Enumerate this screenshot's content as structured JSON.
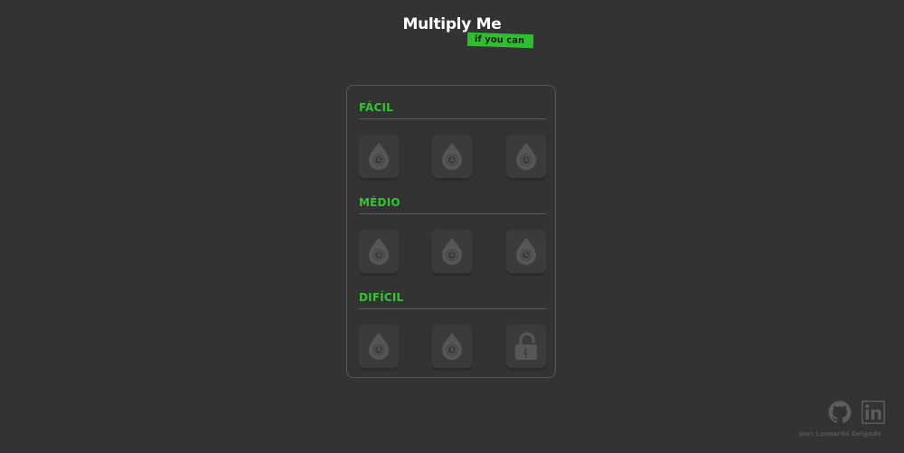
{
  "app": {
    "title": "Multiply Me",
    "subtitle": "if you can"
  },
  "sections": [
    {
      "label": "FÁCIL",
      "levels": [
        {
          "icon": "timer-drop-icon",
          "locked": false
        },
        {
          "icon": "timer-drop-icon",
          "locked": false
        },
        {
          "icon": "timer-drop-icon",
          "locked": false
        }
      ]
    },
    {
      "label": "MÉDIO",
      "levels": [
        {
          "icon": "timer-drop-icon",
          "locked": false
        },
        {
          "icon": "timer-drop-icon",
          "locked": false
        },
        {
          "icon": "timer-drop-icon",
          "locked": false
        }
      ]
    },
    {
      "label": "DIFÍCIL",
      "levels": [
        {
          "icon": "timer-drop-icon",
          "locked": false
        },
        {
          "icon": "timer-drop-icon",
          "locked": false
        },
        {
          "icon": "unlock-icon",
          "locked": false
        }
      ]
    }
  ],
  "footer": {
    "credit": "por: Leonardo Delgado",
    "links": [
      {
        "icon": "github-icon"
      },
      {
        "icon": "linkedin-icon"
      }
    ]
  },
  "colors": {
    "background": "#333333",
    "accent": "#33c433",
    "tile": "#3b3b3b",
    "icon": "#565656"
  }
}
